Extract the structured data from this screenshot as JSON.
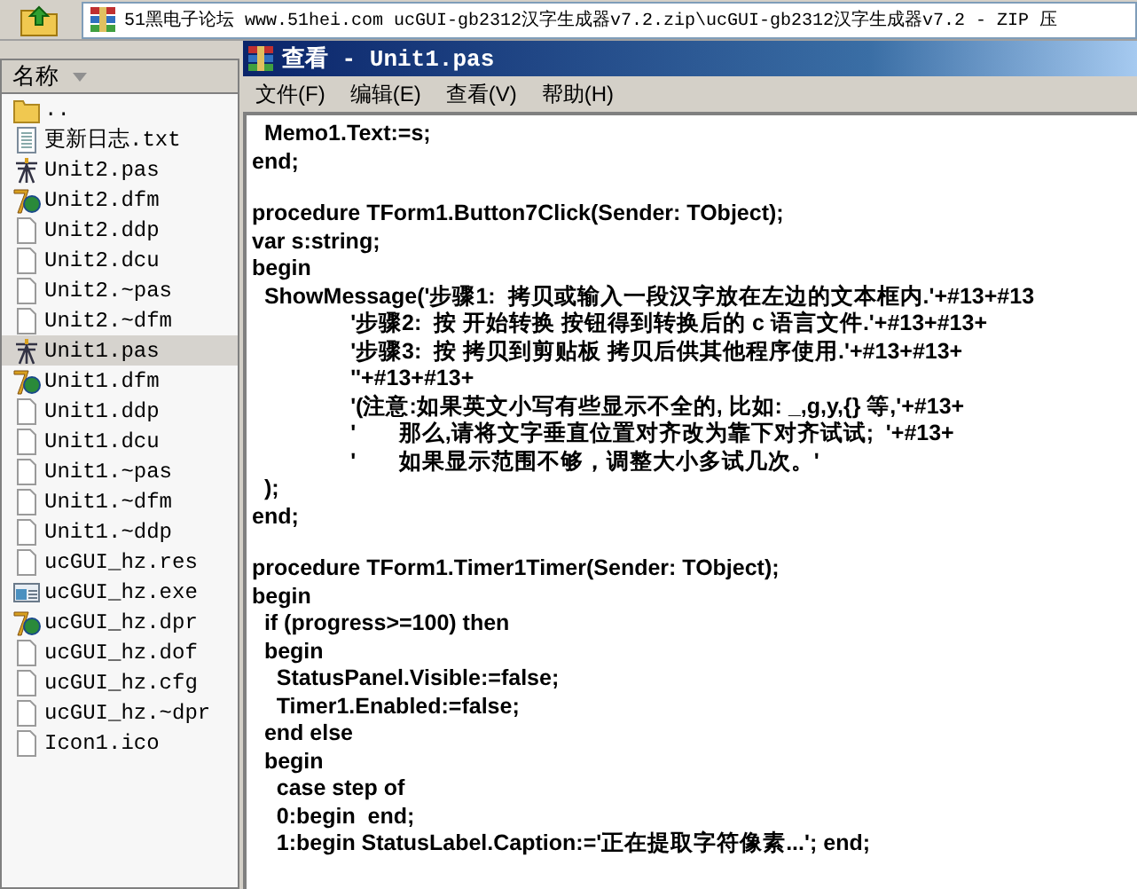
{
  "address_bar": {
    "path": "51黑电子论坛 www.51hei.com ucGUI-gb2312汉字生成器v7.2.zip\\ucGUI-gb2312汉字生成器v7.2 - ZIP 压"
  },
  "file_list": {
    "column_header": "名称",
    "items": [
      {
        "name": "..",
        "kind": "folder",
        "selected": false
      },
      {
        "name": "更新日志.txt",
        "kind": "text",
        "selected": false
      },
      {
        "name": "Unit2.pas",
        "kind": "pas",
        "selected": false
      },
      {
        "name": "Unit2.dfm",
        "kind": "delphi",
        "selected": false
      },
      {
        "name": "Unit2.ddp",
        "kind": "file",
        "selected": false
      },
      {
        "name": "Unit2.dcu",
        "kind": "file",
        "selected": false
      },
      {
        "name": "Unit2.~pas",
        "kind": "file",
        "selected": false
      },
      {
        "name": "Unit2.~dfm",
        "kind": "file",
        "selected": false
      },
      {
        "name": "Unit1.pas",
        "kind": "pas",
        "selected": true
      },
      {
        "name": "Unit1.dfm",
        "kind": "delphi",
        "selected": false
      },
      {
        "name": "Unit1.ddp",
        "kind": "file",
        "selected": false
      },
      {
        "name": "Unit1.dcu",
        "kind": "file",
        "selected": false
      },
      {
        "name": "Unit1.~pas",
        "kind": "file",
        "selected": false
      },
      {
        "name": "Unit1.~dfm",
        "kind": "file",
        "selected": false
      },
      {
        "name": "Unit1.~ddp",
        "kind": "file",
        "selected": false
      },
      {
        "name": "ucGUI_hz.res",
        "kind": "file",
        "selected": false
      },
      {
        "name": "ucGUI_hz.exe",
        "kind": "exe",
        "selected": false
      },
      {
        "name": "ucGUI_hz.dpr",
        "kind": "delphi",
        "selected": false
      },
      {
        "name": "ucGUI_hz.dof",
        "kind": "file",
        "selected": false
      },
      {
        "name": "ucGUI_hz.cfg",
        "kind": "file",
        "selected": false
      },
      {
        "name": "ucGUI_hz.~dpr",
        "kind": "file",
        "selected": false
      },
      {
        "name": "Icon1.ico",
        "kind": "file",
        "selected": false
      }
    ]
  },
  "viewer_window": {
    "title": "查看 - Unit1.pas",
    "menu": [
      "文件(F)",
      "编辑(E)",
      "查看(V)",
      "帮助(H)"
    ],
    "code_blocks": [
      [
        "  Memo1.Text:=s;",
        "end;"
      ],
      [
        "procedure TForm1.Button7Click(Sender: TObject);",
        "var s:string;",
        "begin",
        "  ShowMessage('步骤1:  拷贝或输入一段汉字放在左边的文本框内.'+#13+#13",
        "                '步骤2:  按 开始转换 按钮得到转换后的 c 语言文件.'+#13+#13+",
        "                '步骤3:  按 拷贝到剪贴板 拷贝后供其他程序使用.'+#13+#13+",
        "                ''+#13+#13+",
        "                '(注意:如果英文小写有些显示不全的, 比如: _,g,y,{} 等,'+#13+",
        "                '       那么,请将文字垂直位置对齐改为靠下对齐试试;  '+#13+",
        "                '       如果显示范围不够，调整大小多试几次。'",
        "  );",
        "end;"
      ],
      [
        "procedure TForm1.Timer1Timer(Sender: TObject);",
        "begin",
        "  if (progress>=100) then",
        "  begin",
        "    StatusPanel.Visible:=false;",
        "    Timer1.Enabled:=false;",
        "  end else",
        "  begin",
        "    case step of",
        "    0:begin  end;",
        "    1:begin StatusLabel.Caption:='正在提取字符像素...'; end;"
      ]
    ]
  }
}
